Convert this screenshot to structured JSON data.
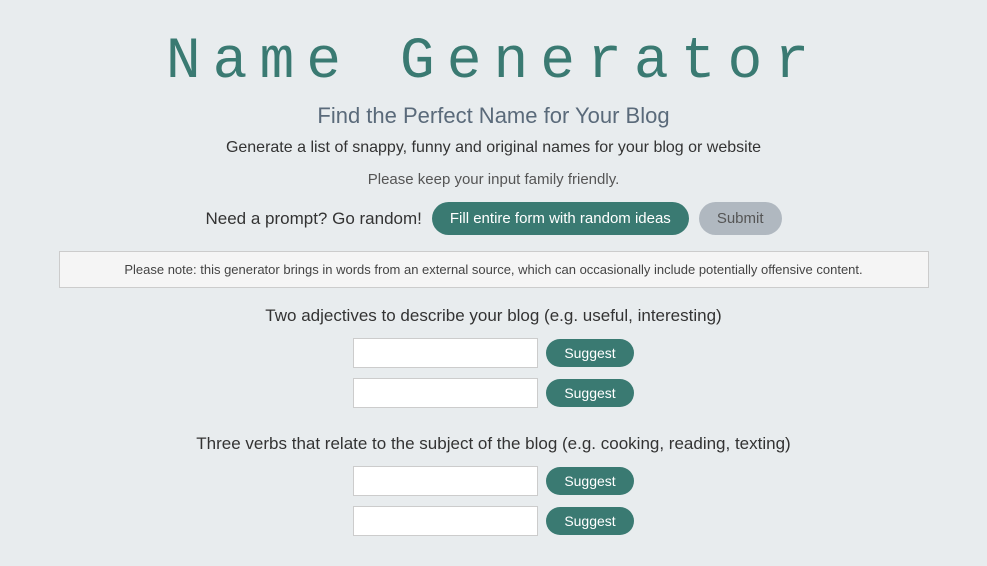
{
  "page": {
    "title": "Name Generator",
    "subtitle": "Find the Perfect Name for Your Blog",
    "description": "Generate a list of snappy, funny and original names for your blog or website",
    "family_friendly_note": "Please keep your input family friendly.",
    "random_label": "Need a prompt? Go random!",
    "random_button_label": "Fill entire form with random ideas",
    "submit_button_label": "Submit",
    "notice": "Please note: this generator brings in words from an external source, which can occasionally include potentially offensive content.",
    "adjectives_section_title": "Two adjectives to describe your blog (e.g. useful, interesting)",
    "verbs_section_title": "Three verbs that relate to the subject of the blog (e.g. cooking, reading, texting)",
    "suggest_label": "Suggest",
    "inputs": {
      "adjective1": "",
      "adjective2": "",
      "verb1": "",
      "verb2": ""
    }
  }
}
